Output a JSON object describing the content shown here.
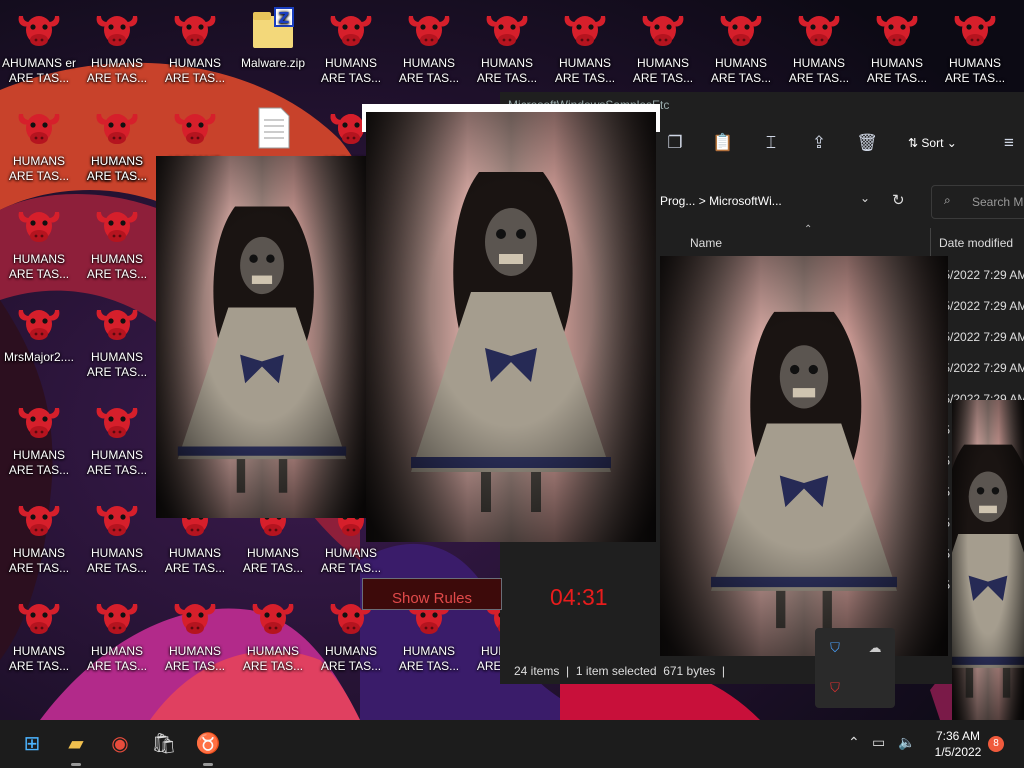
{
  "desktop": {
    "icons": [
      {
        "label": "AHUMANS er\nARE TAS...",
        "kind": "mixed"
      },
      {
        "label": "HUMANS\nARE TAS...",
        "kind": "cow"
      },
      {
        "label": "HUMANS\nARE TAS...",
        "kind": "cow"
      },
      {
        "label": "Malware.zip",
        "kind": "zip"
      },
      {
        "label": "HUMANS\nARE TAS...",
        "kind": "cow"
      },
      {
        "label": "HUMANS\nARE TAS...",
        "kind": "cow"
      },
      {
        "label": "HUMANS\nARE TAS...",
        "kind": "cow"
      },
      {
        "label": "HUMANS\nARE TAS...",
        "kind": "cow"
      },
      {
        "label": "HUMANS\nARE TAS...",
        "kind": "cow"
      },
      {
        "label": "HUMANS\nARE TAS...",
        "kind": "cow"
      },
      {
        "label": "HUMANS\nARE TAS...",
        "kind": "cow"
      },
      {
        "label": "HUMANS\nARE TAS...",
        "kind": "cow"
      },
      {
        "label": "HUMANS\nARE TAS...",
        "kind": "cow"
      },
      {
        "label": "HUMANS\nARE TAS...",
        "kind": "cow"
      },
      {
        "label": "HUMANS\nARE TAS...",
        "kind": "cow"
      },
      {
        "label": "HUMANS\nARE TAS...",
        "kind": "cow"
      },
      {
        "label": "HUMANS\nARE TAS...",
        "kind": "cow"
      },
      {
        "label": "MrsMajor2....",
        "kind": "cow"
      },
      {
        "label": "HUMANS\nARE TAS...",
        "kind": "cow"
      },
      {
        "label": "HUMANS\nARE TAS...",
        "kind": "cow"
      },
      {
        "label": "HUMANS\nARE TAS...",
        "kind": "cow"
      },
      {
        "label": "HUMANS\nARE TAS...",
        "kind": "cow"
      },
      {
        "label": "HUMANS\nARE TAS...",
        "kind": "cow"
      },
      {
        "label": "HUMANS\nARE TAS...",
        "kind": "cow"
      },
      {
        "label": "HUMANS\nARE TAS...",
        "kind": "cow"
      },
      {
        "label": "HUMANS\nARE TAS...",
        "kind": "cow"
      },
      {
        "label": "HUMANS\nARE TAS...",
        "kind": "cow"
      },
      {
        "label": "HUMANS\nARE TAS...",
        "kind": "cow"
      },
      {
        "label": "HUMANS\nARE TAS...",
        "kind": "cow"
      },
      {
        "label": "HUMANS\nARE TAS...",
        "kind": "cow"
      },
      {
        "label": "HUMANS\nARE TAS...",
        "kind": "cow"
      },
      {
        "label": "HUMANS\nARE TAS...",
        "kind": "cow"
      },
      {
        "label": "HUMANS\nARE TAS...",
        "kind": "cow"
      },
      {
        "label": "HUMANS\nARE TAS...",
        "kind": "cow"
      },
      {
        "label": "HUMANS\nARE TAS...",
        "kind": "cow"
      },
      {
        "label": "HUMANS\nARE TAS...",
        "kind": "cow"
      },
      {
        "label": "",
        "kind": "doc"
      },
      {
        "label": "",
        "kind": "cow"
      }
    ]
  },
  "explorer": {
    "title": "MicrosoftWindowsSamplesEtc",
    "toolbar": {
      "sort_label": "Sort"
    },
    "address": {
      "crumb1": "Prog...",
      "sep": ">",
      "crumb2": "MicrosoftWi..."
    },
    "search_placeholder": "Search Mi",
    "columns": {
      "name": "Name",
      "date": "Date modified"
    },
    "rows": [
      "/5/2022 7:29 AM",
      "/5/2022 7:29 AM",
      "/5/2022 7:29 AM",
      "/5/2022 7:29 AM",
      "/5/2022 7:29 AM",
      "/5",
      "/5",
      "/5",
      "/5",
      "/5",
      "/5"
    ],
    "status": {
      "items": "24 items",
      "selected": "1 item selected",
      "size": "671 bytes"
    }
  },
  "game": {
    "rules_label": "Show Rules",
    "timer": "04:31"
  },
  "taskbar": {
    "time": "7:36 AM",
    "date": "1/5/2022",
    "notifications": "8",
    "apps": [
      "start-icon",
      "file-explorer-icon",
      "chrome-icon",
      "store-icon",
      "bull-app-icon"
    ]
  },
  "colors": {
    "accent_red": "#e81c1c",
    "taskbar_bg": "#1c1c1c",
    "explorer_bg": "#1f1f1f",
    "notification_badge": "#f05a3c"
  }
}
